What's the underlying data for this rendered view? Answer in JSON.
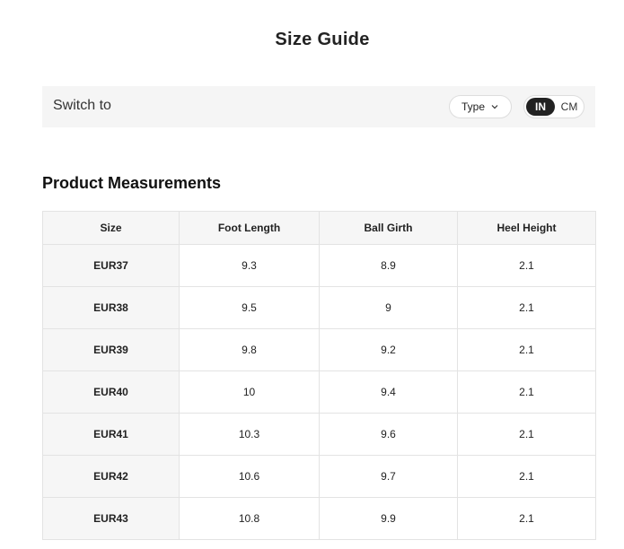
{
  "page": {
    "title": "Size Guide"
  },
  "switch_bar": {
    "label": "Switch to",
    "type_select": {
      "value": "Type"
    },
    "unit_toggle": {
      "options": [
        "IN",
        "CM"
      ],
      "selected": "IN"
    }
  },
  "measurements": {
    "title": "Product Measurements",
    "columns": [
      "Size",
      "Foot Length",
      "Ball Girth",
      "Heel Height"
    ],
    "rows": [
      [
        "EUR37",
        "9.3",
        "8.9",
        "2.1"
      ],
      [
        "EUR38",
        "9.5",
        "9",
        "2.1"
      ],
      [
        "EUR39",
        "9.8",
        "9.2",
        "2.1"
      ],
      [
        "EUR40",
        "10",
        "9.4",
        "2.1"
      ],
      [
        "EUR41",
        "10.3",
        "9.6",
        "2.1"
      ],
      [
        "EUR42",
        "10.6",
        "9.7",
        "2.1"
      ],
      [
        "EUR43",
        "10.8",
        "9.9",
        "2.1"
      ]
    ]
  },
  "colors": {
    "bar_background": "#f5f5f5",
    "toggle_active": "#222222",
    "header_background": "#f6f6f6",
    "border": "#e3e3e3"
  },
  "icons": {
    "type_select": "chevron-down-icon"
  }
}
